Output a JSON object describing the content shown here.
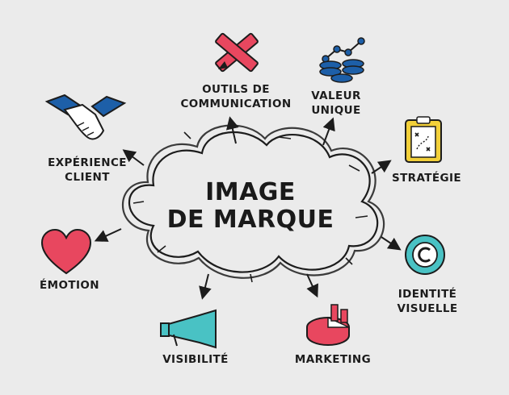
{
  "center": {
    "line1": "IMAGE",
    "line2": "DE MARQUE"
  },
  "nodes": [
    {
      "id": "outils",
      "line1": "OUTILS DE",
      "line2": "COMMUNICATION",
      "icon": "pencil-ruler-icon"
    },
    {
      "id": "valeur",
      "line1": "VALEUR",
      "line2": "UNIQUE",
      "icon": "coins-chart-icon"
    },
    {
      "id": "strategie",
      "line1": "STRATÉGIE",
      "icon": "clipboard-strategy-icon"
    },
    {
      "id": "identite",
      "line1": "IDENTITÉ",
      "line2": "VISUELLE",
      "icon": "copyright-badge-icon"
    },
    {
      "id": "marketing",
      "line1": "MARKETING",
      "icon": "pie-bar-chart-icon"
    },
    {
      "id": "visibilite",
      "line1": "VISIBILITÉ",
      "icon": "megaphone-icon"
    },
    {
      "id": "emotion",
      "line1": "ÉMOTION",
      "icon": "heart-icon"
    },
    {
      "id": "experience",
      "line1": "EXPÉRIENCE",
      "line2": "CLIENT",
      "icon": "handshake-icon"
    }
  ],
  "colors": {
    "background": "#ebebeb",
    "red": "#e8475f",
    "blue": "#1d5fa8",
    "teal": "#49c2c4",
    "yellow": "#f2d03a",
    "ink": "#1c1c1c"
  }
}
